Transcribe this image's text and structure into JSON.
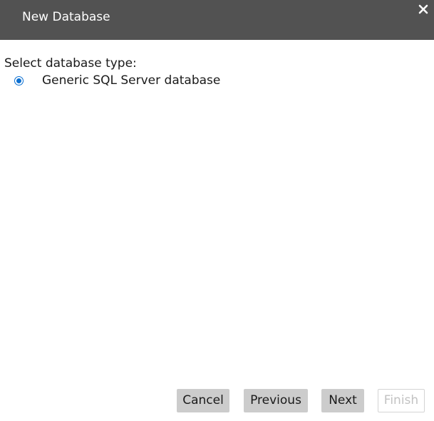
{
  "window": {
    "title": "New Database",
    "close_icon": "close-icon"
  },
  "content": {
    "prompt": "Select database type:",
    "options": [
      {
        "label": "Generic SQL Server database",
        "selected": true
      }
    ]
  },
  "buttons": {
    "cancel": "Cancel",
    "previous": "Previous",
    "next": "Next",
    "finish": "Finish",
    "finish_enabled": false
  },
  "colors": {
    "titlebar": "#525252",
    "accent": "#0b6fd1",
    "button": "#cccccc"
  }
}
